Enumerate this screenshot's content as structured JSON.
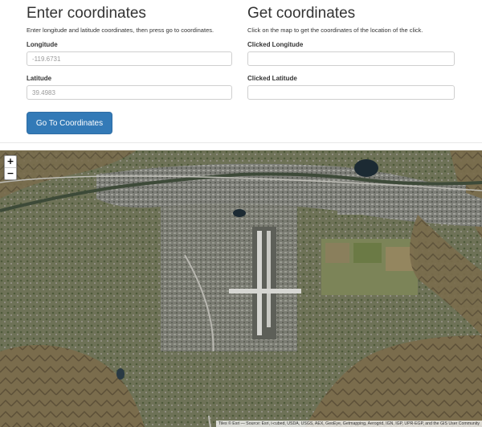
{
  "enter": {
    "title": "Enter coordinates",
    "description": "Enter longitude and latitude coordinates, then press go to coordinates.",
    "longitude_label": "Longitude",
    "longitude_placeholder": "-119.6731",
    "latitude_label": "Latitude",
    "latitude_placeholder": "39.4983",
    "go_button": "Go To Coordinates"
  },
  "get": {
    "title": "Get coordinates",
    "description": "Click on the map to get the coordinates of the location of the click.",
    "clicked_longitude_label": "Clicked Longitude",
    "clicked_longitude_value": "",
    "clicked_latitude_label": "Clicked Latitude",
    "clicked_latitude_value": ""
  },
  "map": {
    "zoom_in": "+",
    "zoom_out": "−",
    "attribution": "Tiles © Esri — Source: Esri, i-cubed, USDA, USGS, AEX, GeoEye, Getmapping, Aerogrid, IGN, IGP, UPR-EGP, and the GIS User Community",
    "imagery": "satellite"
  },
  "colors": {
    "button": "#337ab7",
    "terrain": "#6f6d55",
    "urban": "#8a8a85",
    "river": "#3d4a38",
    "runway": "#d6d6d2"
  }
}
